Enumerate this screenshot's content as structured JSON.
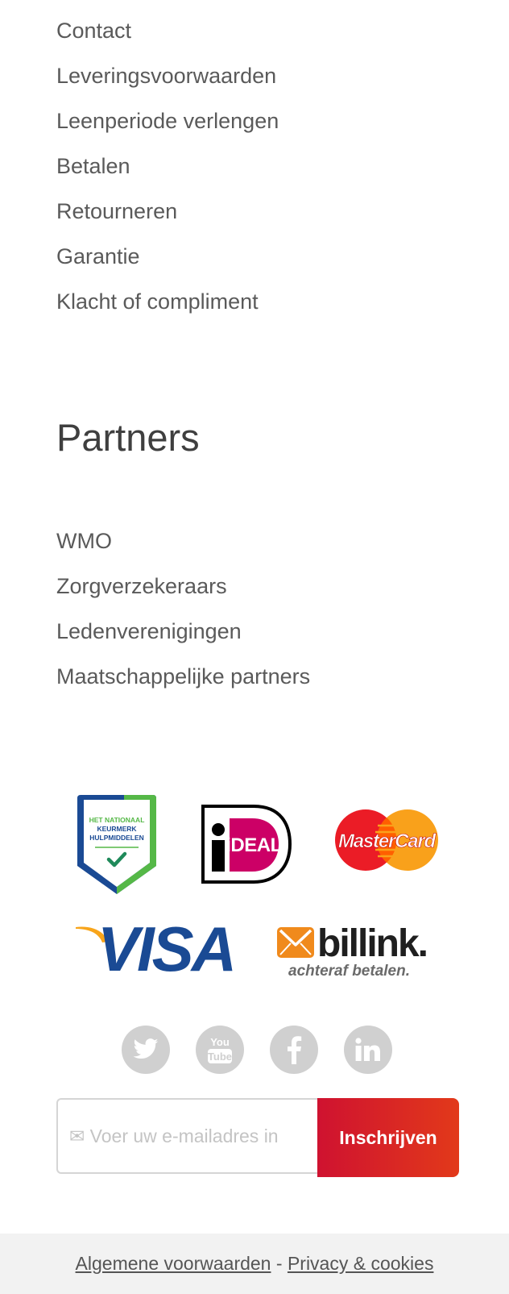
{
  "service_links": [
    "Contact",
    "Leveringsvoorwaarden",
    "Leenperiode verlengen",
    "Betalen",
    "Retourneren",
    "Garantie",
    "Klacht of compliment"
  ],
  "partners": {
    "title": "Partners",
    "links": [
      "WMO",
      "Zorgverzekeraars",
      "Ledenverenigingen",
      "Maatschappelijke partners"
    ]
  },
  "logos": {
    "keurmerk": {
      "line1": "HET NATIONAAL",
      "line2": "KEURMERK",
      "line3": "HULPMIDDELEN"
    },
    "ideal": "iDEAL",
    "mastercard": "MasterCard",
    "visa": "VISA",
    "billink": {
      "name": "billink.",
      "tagline": "achteraf betalen."
    }
  },
  "social": [
    "twitter-icon",
    "youtube-icon",
    "facebook-icon",
    "linkedin-icon"
  ],
  "newsletter": {
    "placeholder": "✉ Voer uw e-mailadres in",
    "button": "Inschrijven"
  },
  "footer": {
    "terms": "Algemene voorwaarden",
    "separator": "-",
    "privacy": "Privacy & cookies"
  },
  "colors": {
    "accent_red": "#cf1230",
    "accent_orange": "#e2391a",
    "keurmerk_blue": "#1a4a94",
    "keurmerk_green": "#55b847",
    "ideal_pink": "#cc0066",
    "visa_blue": "#1a4a94",
    "billink_orange": "#f08a1c",
    "social_grey": "#d0d0d0"
  }
}
